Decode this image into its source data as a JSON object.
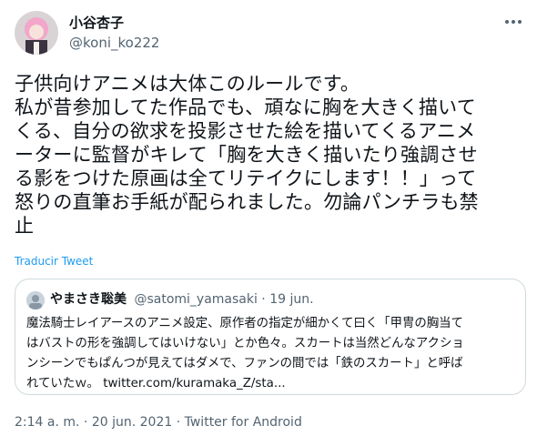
{
  "author": {
    "display_name": "小谷杏子",
    "handle": "@koni_ko222"
  },
  "tweet": {
    "text": "子供向けアニメは大体このルールです。\n私が昔参加してた作品でも、頑なに胸を大きく描いて\nくる、自分の欲求を投影させた絵を描いてくるアニメ\nーターに監督がキレて「胸を大きく描いたり強調させ\nる影をつけた原画は全てリテイクにします！！」って\n怒りの直筆お手紙が配られました。勿論パンチラも禁\n止",
    "translate_label": "Traducir Tweet"
  },
  "quote": {
    "display_name": "やまさき聡美",
    "handle": "@satomi_yamasaki",
    "separator": " · ",
    "date": "19 jun.",
    "text": "魔法騎士レイアースのアニメ設定、原作者の指定が細かくて曰く「甲冑の胸当て\nはバストの形を強調してはいけない」とか色々。スカートは当然どんなアクショ\nンシーンでもぱんつが見えてはダメで、ファンの間では「鉄のスカート」と呼ば\nれていたｗ。",
    "link": "twitter.com/kuramaka_Z/sta..."
  },
  "footer": {
    "time": "2:14 a. m.",
    "date": "20 jun. 2021",
    "client": "Twitter for Android",
    "separator": " · "
  },
  "colors": {
    "accent": "#1d9bf0",
    "text": "#0f1419",
    "secondary": "#536471",
    "border": "#cfd9de"
  },
  "icons": {
    "more": "more-horizontal-icon"
  }
}
